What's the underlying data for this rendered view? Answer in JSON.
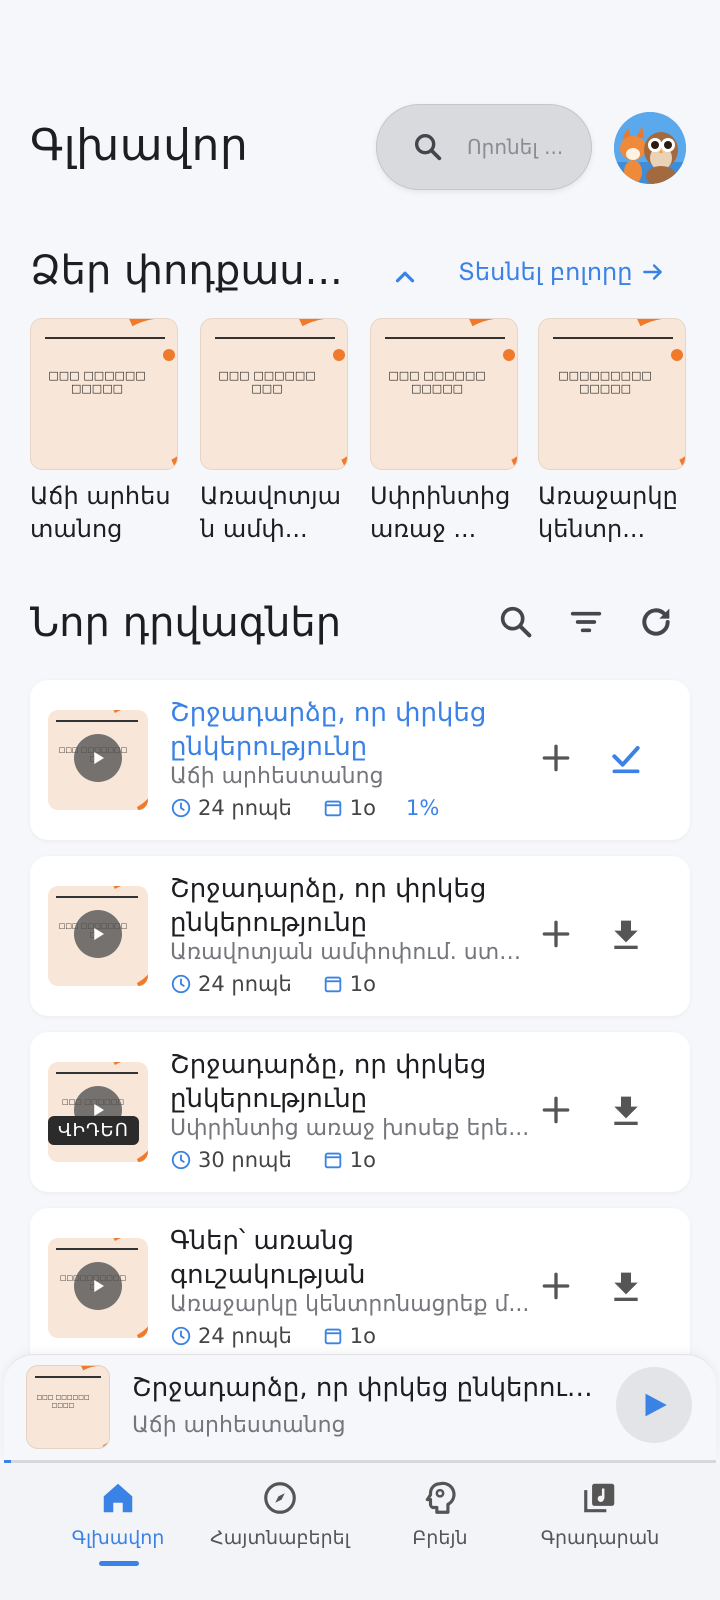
{
  "header": {
    "title": "Գլխավոր",
    "search_placeholder": "Որոնել ...",
    "avatar_icon": "fox-owl-avatar"
  },
  "subscriptions": {
    "title": "Ձեր փոդքաս...",
    "see_all": "Տեսնել բոլորը",
    "items": [
      {
        "name": "Աճի արհեստանոց",
        "cover_text": "□□□ □□□□□□□□□□□"
      },
      {
        "name": "Առավոտյան ամփ...",
        "cover_text": "□□□ □□□□□□□□□"
      },
      {
        "name": "Սփրինտից առաջ ...",
        "cover_text": "□□□ □□□□□□□□□□□"
      },
      {
        "name": "Առաջարկը կենտր...",
        "cover_text": "□□□□□□□□□□□□□□"
      }
    ]
  },
  "new_episodes": {
    "title": "Նոր դրվագներ",
    "items": [
      {
        "title": "Շրջադարձը, որ փրկեց ընկերությունը",
        "podcast": "Աճի արհեստանոց",
        "duration": "24 րոպե",
        "date": "1օ",
        "progress": "1%",
        "status": "played",
        "cover_text": "□□□ □□□□□□□□"
      },
      {
        "title": "Շրջադարձը, որ փրկեց ընկերությունը",
        "podcast": "Առավոտյան ամփոփում. ստո...",
        "duration": "24 րոպե",
        "date": "1օ",
        "status": "download",
        "cover_text": "□□□ □□□□□□□□"
      },
      {
        "title": "Շրջադարձը, որ փրկեց ընկերությունը",
        "podcast": "Սփրինտից առաջ խոսեք երե...",
        "duration": "30 րոպե",
        "date": "1օ",
        "status": "download",
        "badge": "ՎԻԴԵՈ",
        "cover_text": "□□□ □□□□□□"
      },
      {
        "title": "Գներ՝ առանց գուշակության",
        "podcast": "Առաջարկը կենտրոնացրեք մ...",
        "duration": "24 րոպե",
        "date": "1օ",
        "status": "download",
        "cover_text": "□□□□□□□□□□□"
      }
    ]
  },
  "player": {
    "title": "Շրջադարձը, որ փրկեց ընկերությունը",
    "podcast": "Աճի արհեստանոց",
    "progress_fraction": 0.01,
    "cover_text": "□□□ □□□□□□□□□□"
  },
  "nav": {
    "items": [
      {
        "label": "Գլխավոր",
        "icon": "home-icon",
        "active": true
      },
      {
        "label": "Հայտնաբերել",
        "icon": "compass-icon"
      },
      {
        "label": "Բրեյն",
        "icon": "brain-icon"
      },
      {
        "label": "Գրադարան",
        "icon": "library-icon"
      }
    ]
  },
  "colors": {
    "accent": "#3b82e6",
    "cover_orange": "#ef7a2c",
    "cover_bg": "#f8e7d8"
  }
}
